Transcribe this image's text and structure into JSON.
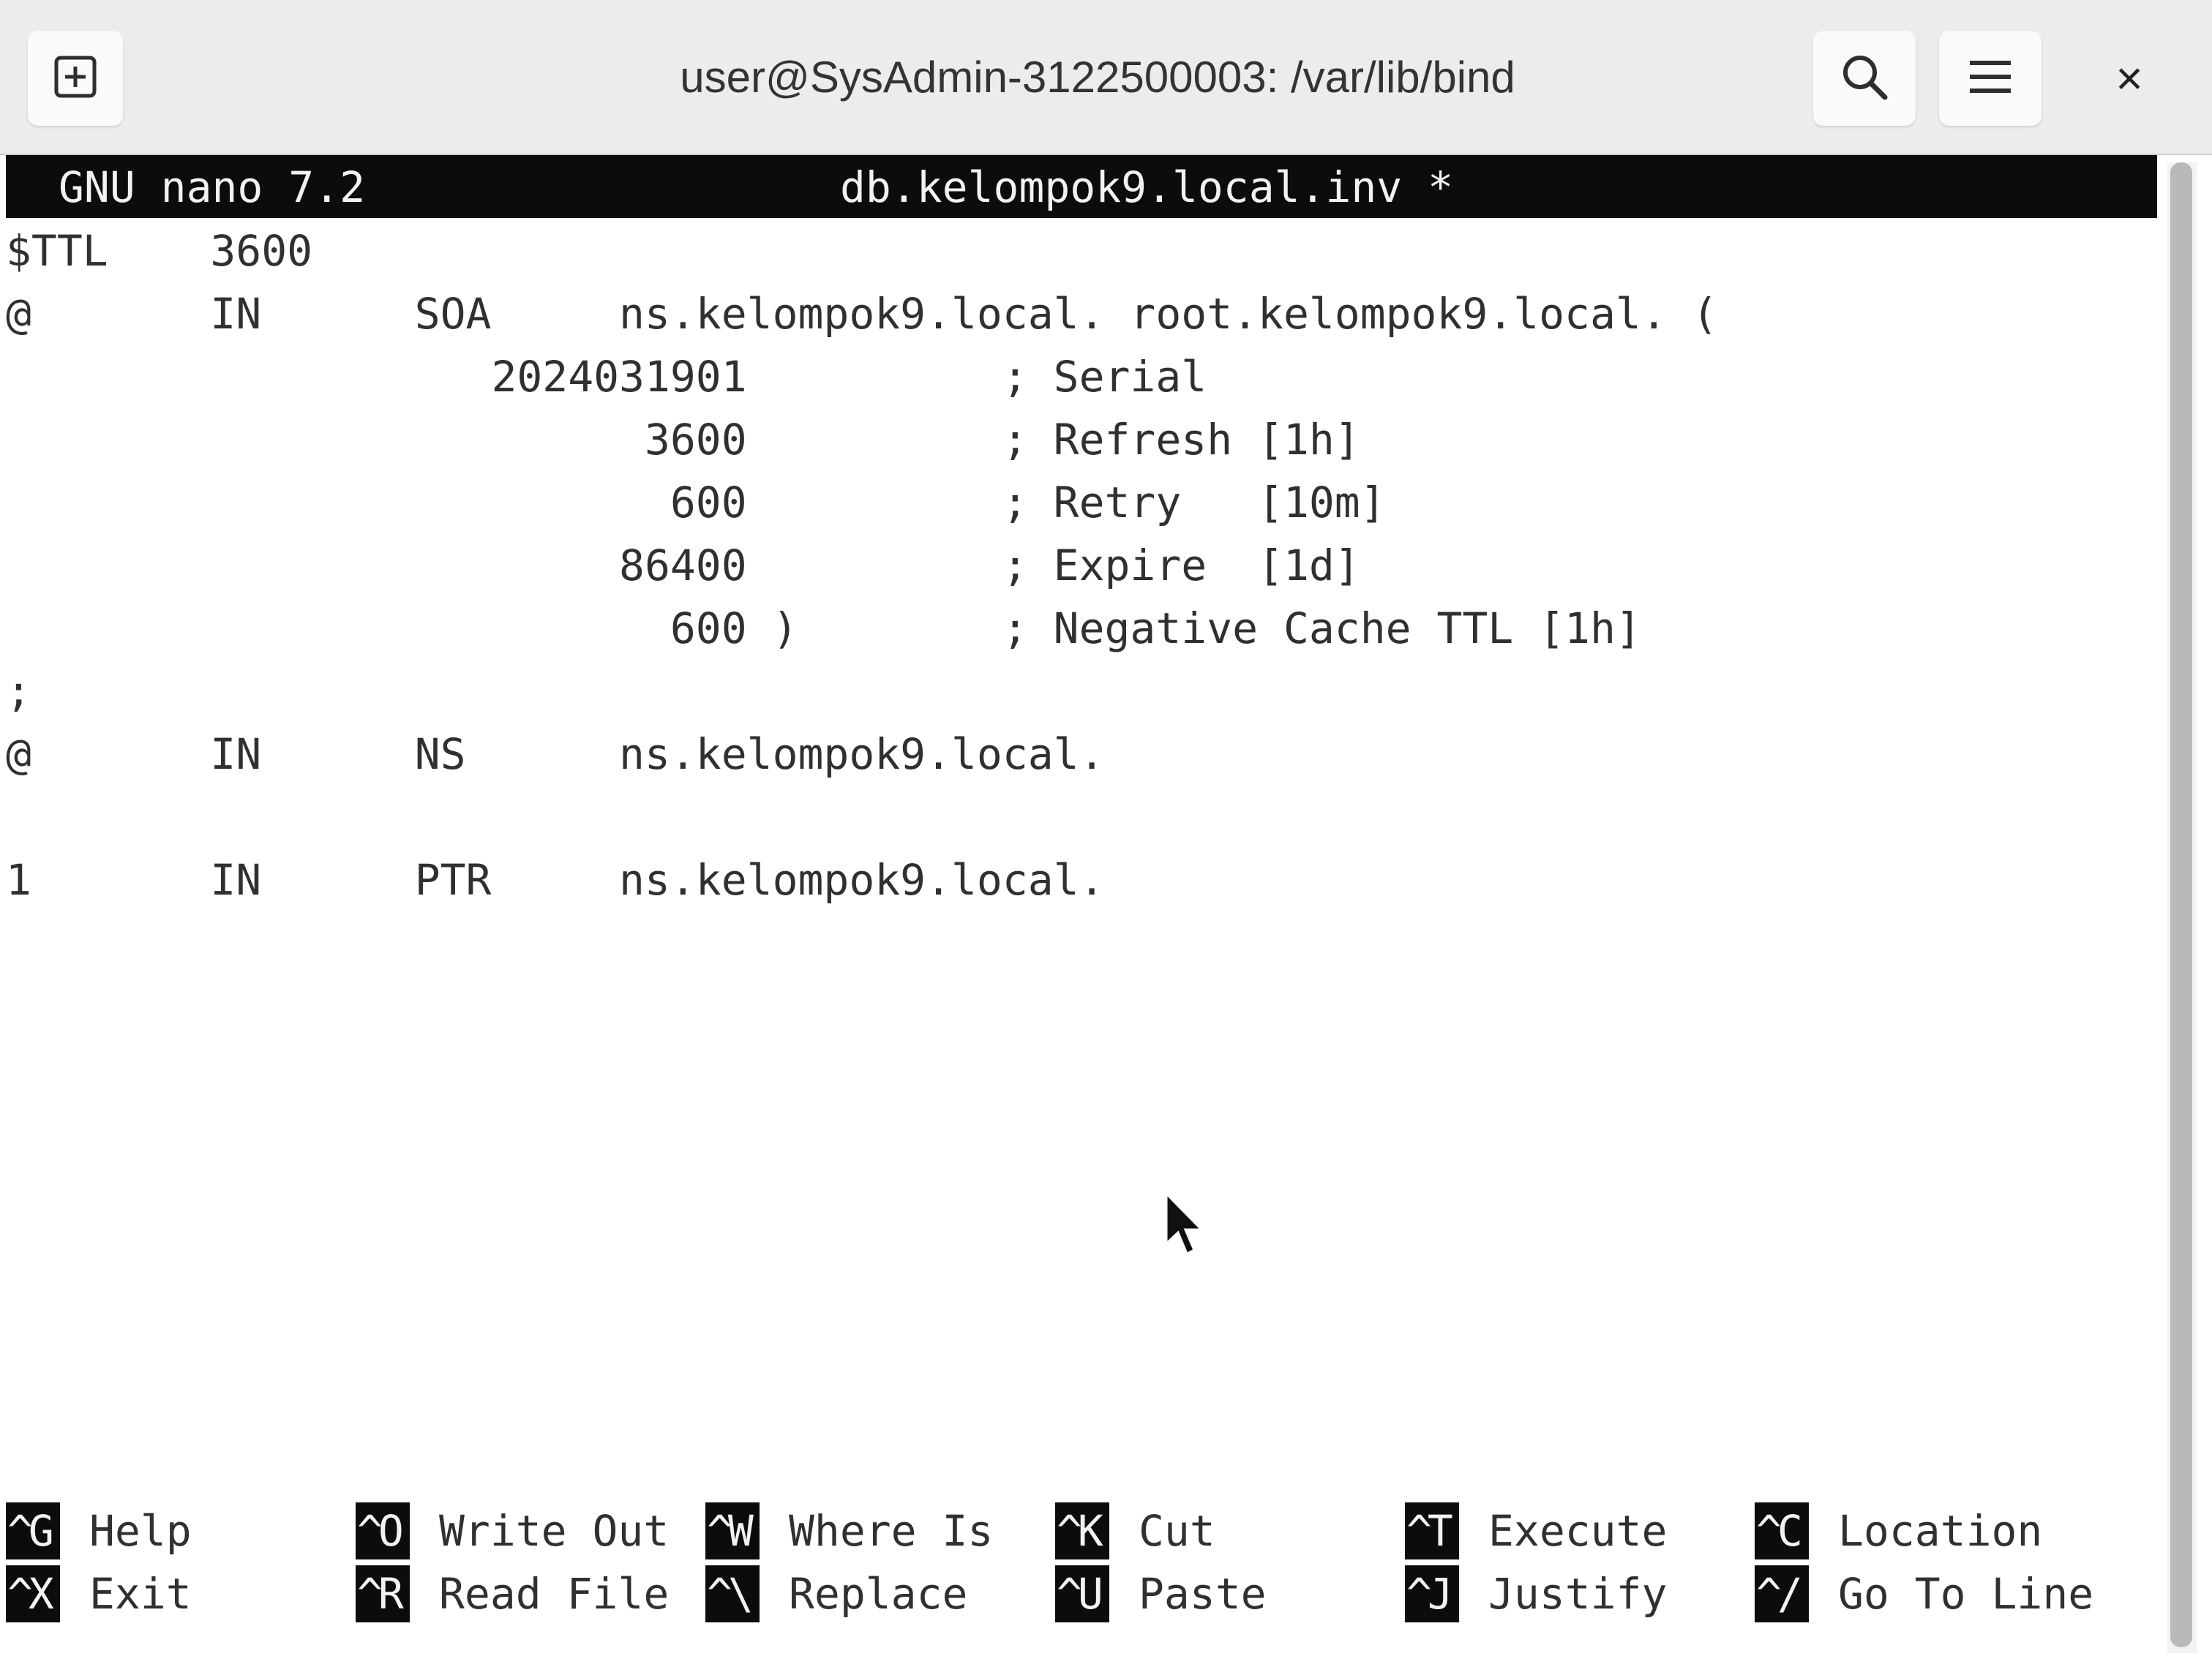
{
  "window": {
    "title": "user@SysAdmin-3122500003: /var/lib/bind",
    "close_label": "×"
  },
  "nano": {
    "version": "GNU nano 7.2",
    "filename": "db.kelompok9.local.inv *"
  },
  "file_lines": [
    "$TTL    3600",
    "@       IN      SOA     ns.kelompok9.local. root.kelompok9.local. (",
    "                   2024031901          ; Serial",
    "                         3600          ; Refresh [1h]",
    "                          600          ; Retry   [10m]",
    "                        86400          ; Expire  [1d]",
    "                          600 )        ; Negative Cache TTL [1h]",
    ";",
    "@       IN      NS      ns.kelompok9.local.",
    "",
    "1       IN      PTR     ns.kelompok9.local."
  ],
  "shortcuts": [
    {
      "key": "^G",
      "label": "Help"
    },
    {
      "key": "^O",
      "label": "Write Out"
    },
    {
      "key": "^W",
      "label": "Where Is"
    },
    {
      "key": "^K",
      "label": "Cut"
    },
    {
      "key": "^T",
      "label": "Execute"
    },
    {
      "key": "^C",
      "label": "Location"
    },
    {
      "key": "^X",
      "label": "Exit"
    },
    {
      "key": "^R",
      "label": "Read File"
    },
    {
      "key": "^\\",
      "label": "Replace"
    },
    {
      "key": "^U",
      "label": "Paste"
    },
    {
      "key": "^J",
      "label": "Justify"
    },
    {
      "key": "^/",
      "label": "Go To Line"
    }
  ],
  "icons": {
    "new_tab": "new-tab-icon",
    "search": "search-icon",
    "menu": "hamburger-menu-icon",
    "close": "close-icon",
    "cursor": "mouse-pointer-icon"
  }
}
